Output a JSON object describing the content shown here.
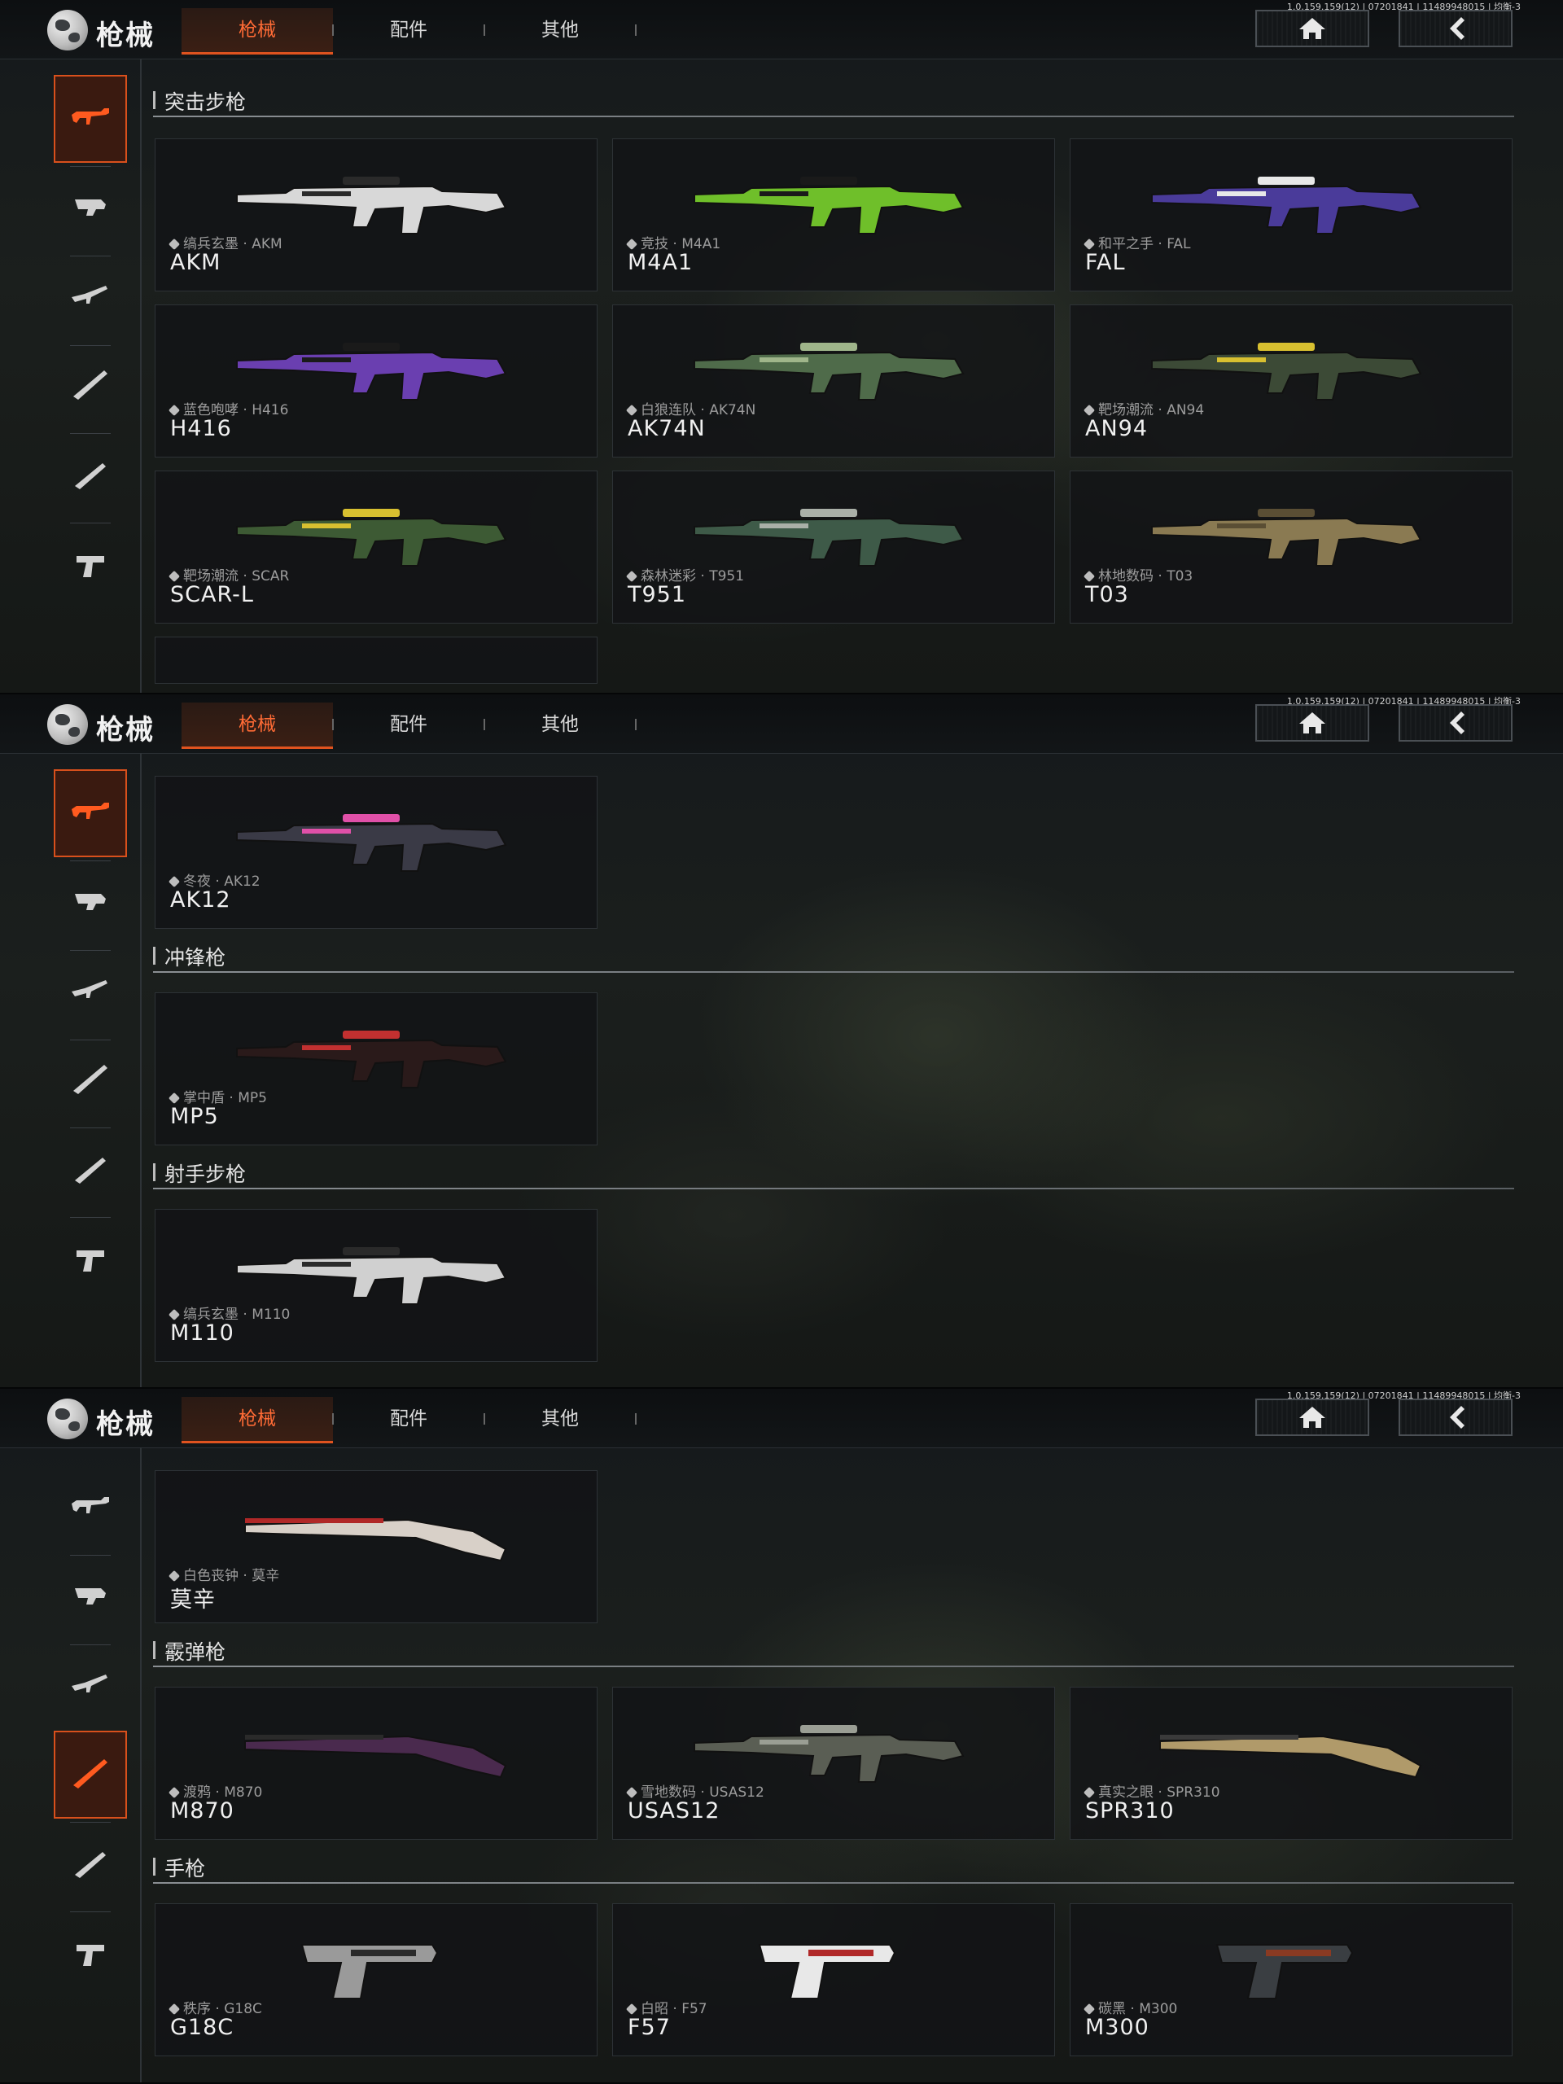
{
  "app": {
    "title": "枪械"
  },
  "version": "1.0.159.159(12) | 07201841 | 11489948015 | 均衡-3",
  "tabs": [
    {
      "label": "枪械",
      "active": true
    },
    {
      "label": "配件",
      "active": false
    },
    {
      "label": "其他",
      "active": false
    }
  ],
  "nav_icons": {
    "home": "home-icon",
    "back": "back-arrow-icon"
  },
  "colors": {
    "accent": "#e0531f",
    "accent_text": "#ff6b35",
    "card_bg": "#121416"
  },
  "sidebar_icons": [
    "assault-rifle-icon",
    "smg-icon",
    "marksman-rifle-icon",
    "sniper-rifle-icon",
    "shotgun-icon",
    "pistol-icon"
  ],
  "panels": [
    {
      "active_sidebar_index": 0,
      "sections": [
        {
          "label": "突击步枪"
        }
      ],
      "cards": [
        {
          "skin": "缟兵玄墨 · AKM",
          "name": "AKM",
          "gun_color": "#d8d8d8",
          "accent": "#2a2a2a"
        },
        {
          "skin": "竞技 · M4A1",
          "name": "M4A1",
          "gun_color": "#6fbf2a",
          "accent": "#1a1a1a"
        },
        {
          "skin": "和平之手 · FAL",
          "name": "FAL",
          "gun_color": "#4a3b9a",
          "accent": "#e8e8e8"
        },
        {
          "skin": "蓝色咆哮 · H416",
          "name": "H416",
          "gun_color": "#6a3fb0",
          "accent": "#1a1a1a"
        },
        {
          "skin": "白狼连队 · AK74N",
          "name": "AK74N",
          "gun_color": "#4f6b4a",
          "accent": "#9fb58a"
        },
        {
          "skin": "靶场潮流 · AN94",
          "name": "AN94",
          "gun_color": "#3c4a36",
          "accent": "#d8c030"
        },
        {
          "skin": "靶场潮流 · SCAR",
          "name": "SCAR-L",
          "gun_color": "#3d5a34",
          "accent": "#d8c030"
        },
        {
          "skin": "森林迷彩 · T951",
          "name": "T951",
          "gun_color": "#3e5a48",
          "accent": "#aab0a8"
        },
        {
          "skin": "林地数码 · T03",
          "name": "T03",
          "gun_color": "#8a7a52",
          "accent": "#5a4e34"
        }
      ]
    },
    {
      "active_sidebar_index": 0,
      "sections": [
        {
          "label": "冲锋枪"
        },
        {
          "label": "射手步枪"
        }
      ],
      "cards": [
        {
          "skin": "冬夜 · AK12",
          "name": "AK12",
          "gun_color": "#3a3a46",
          "accent": "#e050a8"
        },
        {
          "skin": "掌中盾 · MP5",
          "name": "MP5",
          "gun_color": "#2a1a1a",
          "accent": "#c23030"
        },
        {
          "skin": "缟兵玄墨 · M110",
          "name": "M110",
          "gun_color": "#d0d0d0",
          "accent": "#2a2a2a"
        }
      ]
    },
    {
      "active_sidebar_index": 3,
      "sections": [
        {
          "label": "霰弹枪"
        },
        {
          "label": "手枪"
        }
      ],
      "cards": [
        {
          "skin": "白色丧钟 · 莫辛",
          "name": "莫辛",
          "gun_color": "#d8d0c8",
          "accent": "#b02828"
        },
        {
          "skin": "渡鸦 · M870",
          "name": "M870",
          "gun_color": "#4a2a4e",
          "accent": "#2a2a2a"
        },
        {
          "skin": "雪地数码 · USAS12",
          "name": "USAS12",
          "gun_color": "#5a5e54",
          "accent": "#9a9e94"
        },
        {
          "skin": "真实之眼 · SPR310",
          "name": "SPR310",
          "gun_color": "#b09a6a",
          "accent": "#3a3a3a"
        },
        {
          "skin": "秩序 · G18C",
          "name": "G18C",
          "gun_color": "#9a9a9a",
          "accent": "#2a2a2a"
        },
        {
          "skin": "白昭 · F57",
          "name": "F57",
          "gun_color": "#e8e8e8",
          "accent": "#b02828"
        },
        {
          "skin": "碳黑 · M300",
          "name": "M300",
          "gun_color": "#3a3e42",
          "accent": "#8a3a22"
        }
      ]
    }
  ]
}
